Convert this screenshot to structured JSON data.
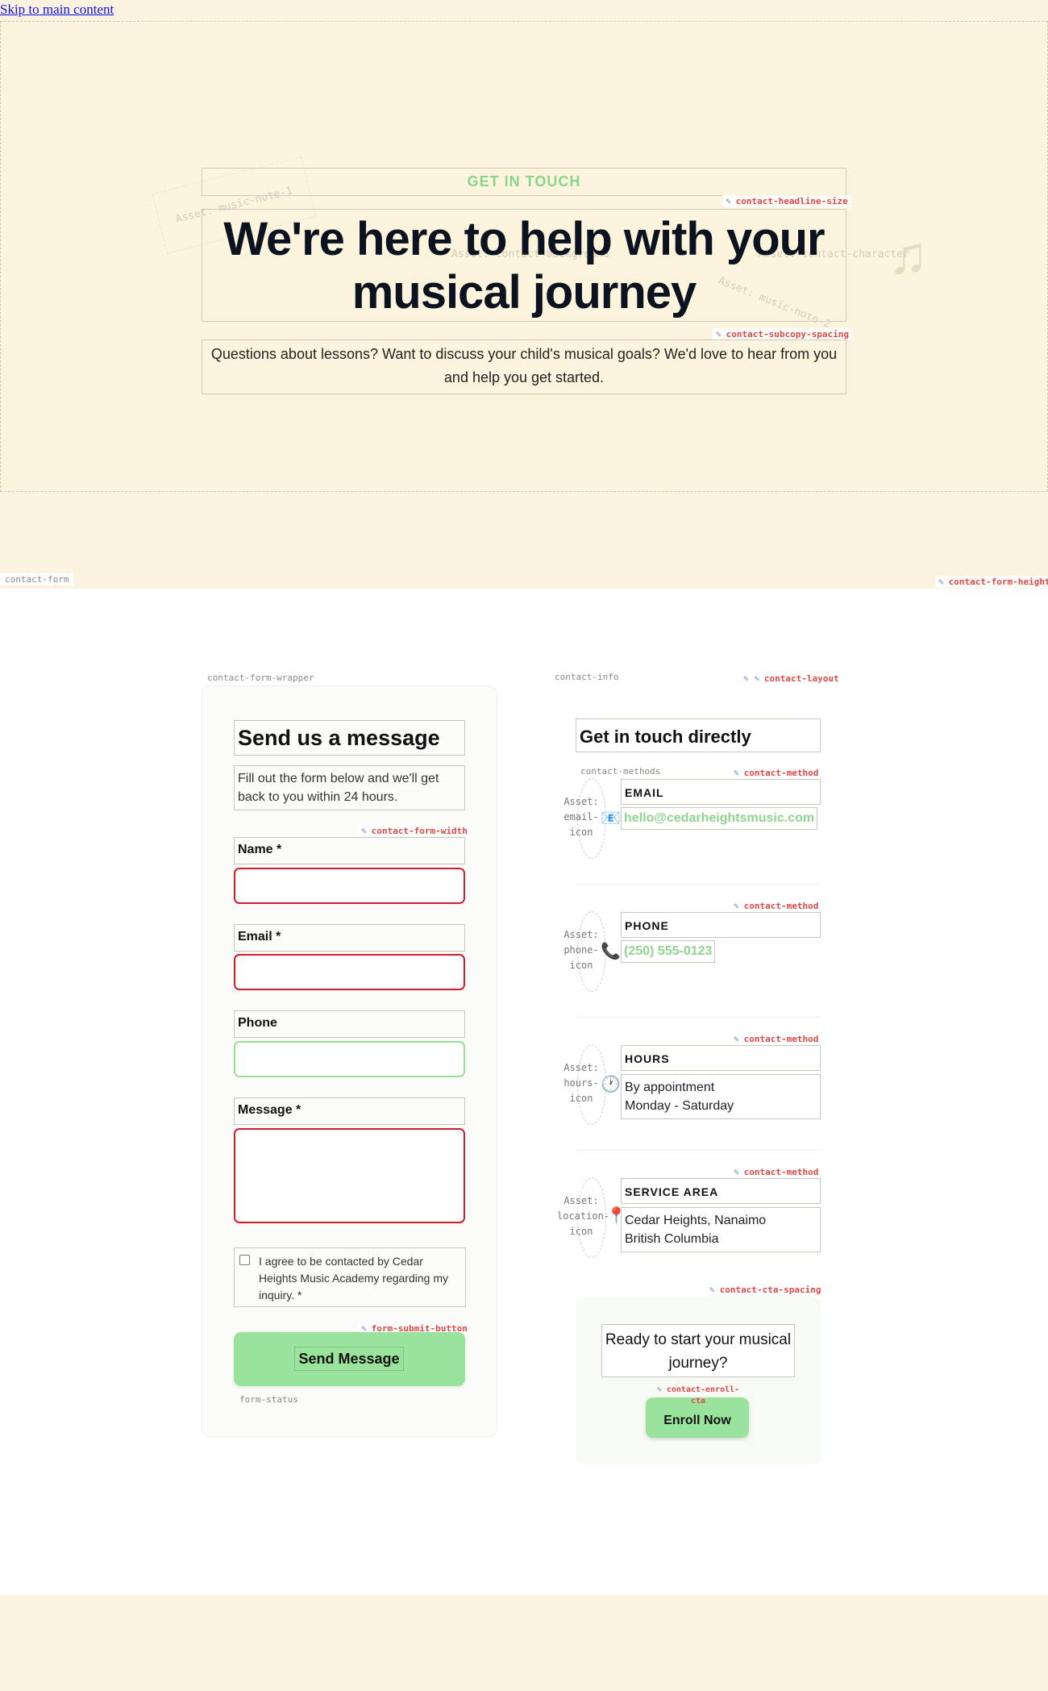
{
  "skip_link": "Skip to main content",
  "hero": {
    "eyebrow": "GET IN TOUCH",
    "headline": "We're here to help with your musical journey",
    "subcopy": "Questions about lessons? Want to discuss your child's musical goals? We'd love to hear from you and help you get started.",
    "asset_background": "Asset: contact-background",
    "asset_note1": "Asset: music-note-1",
    "asset_note2": "Asset: music-note-2",
    "asset_character": "Asset: contact-character",
    "note_icon": "music-note-icon"
  },
  "annotations": {
    "headline_size": "contact-headline-size",
    "subcopy_spacing": "contact-subcopy-spacing",
    "contact_form": "contact-form",
    "contact_form_height": "contact-form-height",
    "form_wrapper": "contact-form-wrapper",
    "contact_info": "contact-info",
    "contact_layout": "contact-layout",
    "form_width": "contact-form-width",
    "submit_button": "form-submit-button",
    "form_status": "form-status",
    "contact_methods": "contact-methods",
    "contact_method": "contact-method",
    "cta_spacing": "contact-cta-spacing",
    "enroll_cta": "contact-enroll-cta"
  },
  "form": {
    "title": "Send us a message",
    "intro": "Fill out the form below and we'll get back to you within 24 hours.",
    "name_label": "Name *",
    "email_label": "Email *",
    "phone_label": "Phone",
    "message_label": "Message *",
    "name_value": "",
    "email_value": "",
    "phone_value": "",
    "message_value": "",
    "consent": "I agree to be contacted by Cedar Heights Music Academy regarding my inquiry. *",
    "submit": "Send Message"
  },
  "info": {
    "title": "Get in touch directly",
    "methods": [
      {
        "asset": "Asset: email-icon",
        "icon": "email-icon",
        "title": "EMAIL",
        "value": "hello@cedarheightsmusic.com"
      },
      {
        "asset": "Asset: phone-icon",
        "icon": "phone-icon",
        "title": "PHONE",
        "value": "(250) 555-0123"
      },
      {
        "asset": "Asset: hours-icon",
        "icon": "clock-icon",
        "title": "HOURS",
        "line1": "By appointment",
        "line2": "Monday - Saturday"
      },
      {
        "asset": "Asset: location-icon",
        "icon": "map-pin-icon",
        "title": "SERVICE AREA",
        "line1": "Cedar Heights, Nanaimo",
        "line2": "British Columbia"
      }
    ],
    "cta_text": "Ready to start your musical journey?",
    "enroll": "Enroll Now"
  },
  "colors": {
    "accent_green": "#9ae39c",
    "link_green": "#8fd58f",
    "error_red": "#d21e2b",
    "cream": "#fbf3df"
  }
}
